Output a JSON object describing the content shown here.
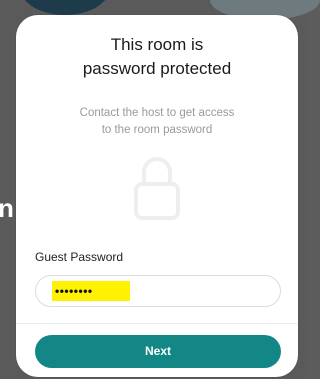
{
  "background": {
    "partial_heading_letter": "n"
  },
  "modal": {
    "title_line1": "This room is",
    "title_line2": "password protected",
    "subtitle_line1": "Contact the host to get access",
    "subtitle_line2": "to the room password",
    "lock_icon": "lock-icon",
    "field_label": "Guest Password",
    "password_value": "••••••••",
    "next_label": "Next"
  },
  "colors": {
    "accent": "#138785",
    "highlight": "#fff200",
    "modal_bg": "#ffffff",
    "overlay_bg": "#5a5a5a"
  }
}
